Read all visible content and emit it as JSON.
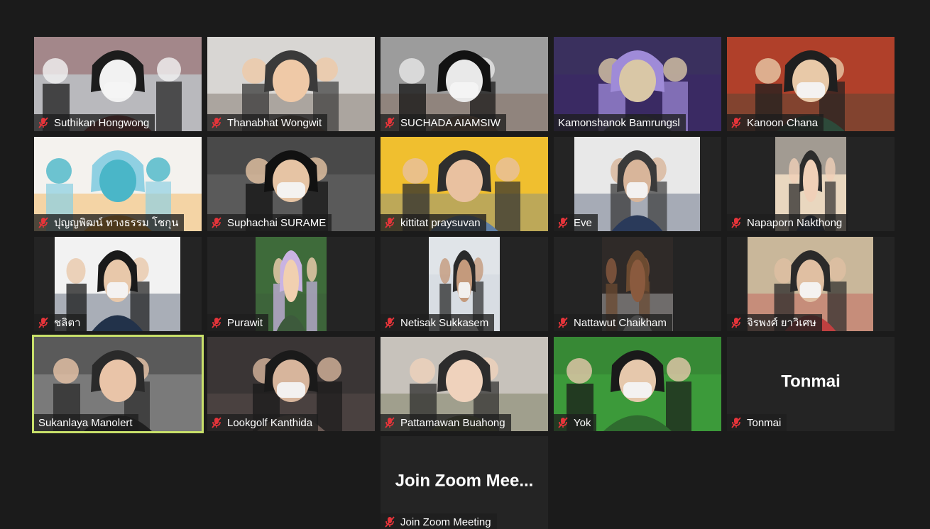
{
  "meeting": {
    "app": "Zoom",
    "view": "Gallery View",
    "accent_color": "#c8e06a",
    "muted_icon_color": "#e5343a",
    "tile_background": "#242424",
    "window_background": "#1b1b1b"
  },
  "participants": [
    {
      "name": "Suthikan Hongwong",
      "muted": true,
      "video": true,
      "active": false
    },
    {
      "name": "Thanabhat Wongwit",
      "muted": true,
      "video": true,
      "active": false
    },
    {
      "name": "SUCHADA AIAMSIW",
      "muted": true,
      "video": true,
      "active": false
    },
    {
      "name": "Kamonshanok Bamrungsl",
      "muted": false,
      "video": true,
      "active": false
    },
    {
      "name": "Kanoon Chana",
      "muted": true,
      "video": true,
      "active": false
    },
    {
      "name": "ปุญญพิฒน์ ทางธรรม โชกุน",
      "muted": true,
      "video": true,
      "active": false
    },
    {
      "name": "Suphachai SURAME",
      "muted": true,
      "video": true,
      "active": false
    },
    {
      "name": "kittitat praysuvan",
      "muted": true,
      "video": true,
      "active": false
    },
    {
      "name": "Eve",
      "muted": true,
      "video": true,
      "active": false
    },
    {
      "name": "Napaporn Nakthong",
      "muted": true,
      "video": true,
      "active": false
    },
    {
      "name": "ชลิตา",
      "muted": true,
      "video": true,
      "active": false
    },
    {
      "name": "Purawit",
      "muted": true,
      "video": true,
      "active": false
    },
    {
      "name": "Netisak Sukkasem",
      "muted": true,
      "video": true,
      "active": false
    },
    {
      "name": "Nattawut Chaikham",
      "muted": true,
      "video": true,
      "active": false
    },
    {
      "name": "จิรพงศ์ ยาวิเศษ",
      "muted": true,
      "video": true,
      "active": false
    },
    {
      "name": "Sukanlaya Manolert",
      "muted": false,
      "video": true,
      "active": true
    },
    {
      "name": "Lookgolf Kanthida",
      "muted": true,
      "video": true,
      "active": false
    },
    {
      "name": "Pattamawan Buahong",
      "muted": true,
      "video": true,
      "active": false
    },
    {
      "name": "Yok",
      "muted": true,
      "video": true,
      "active": false
    },
    {
      "name": "Tonmai",
      "muted": true,
      "video": false,
      "active": false,
      "display_name": "Tonmai"
    },
    {
      "name": "Join Zoom Meeting",
      "muted": true,
      "video": false,
      "active": false,
      "display_name": "Join Zoom Mee..."
    }
  ]
}
